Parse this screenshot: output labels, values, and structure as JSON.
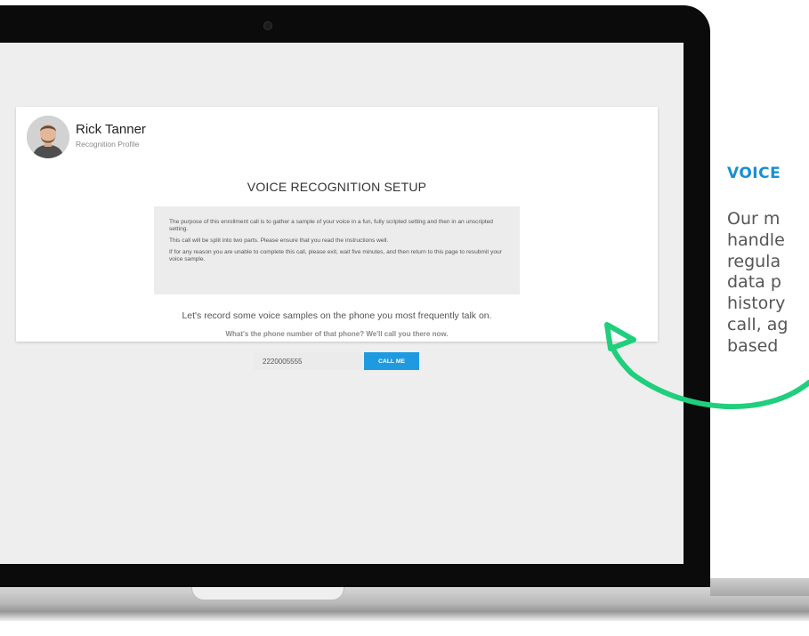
{
  "profile": {
    "name": "Rick Tanner",
    "subtitle": "Recognition Profile"
  },
  "setup": {
    "title": "VOICE RECOGNITION SETUP",
    "info": [
      "The purpose of this enrollment call is to gather a sample of your voice in a fun, fully scripted setting and then in an unscripted setting.",
      "This call will be split into two parts. Please ensure that you read the instructions well.",
      "If for any reason you are unable to complete this call, please exit, wait five minutes, and then return to this page to resubmit your voice sample."
    ],
    "prompt": "Let's record some voice samples on the phone you most frequently talk on.",
    "question": "What's the phone number of that phone? We'll call you there now.",
    "phone_value": "2220005555",
    "call_button": "CALL ME"
  },
  "side": {
    "heading": "VOICE",
    "lines": [
      "Our m",
      "handle",
      "regula",
      "data p",
      "history",
      "call, ag",
      "based"
    ]
  },
  "colors": {
    "accent": "#1e9be0",
    "heading_blue": "#1a8fd1",
    "arrow_green": "#1fcf7c"
  },
  "icons": {
    "arrow": "curved-arrow-icon",
    "avatar": "user-avatar"
  }
}
